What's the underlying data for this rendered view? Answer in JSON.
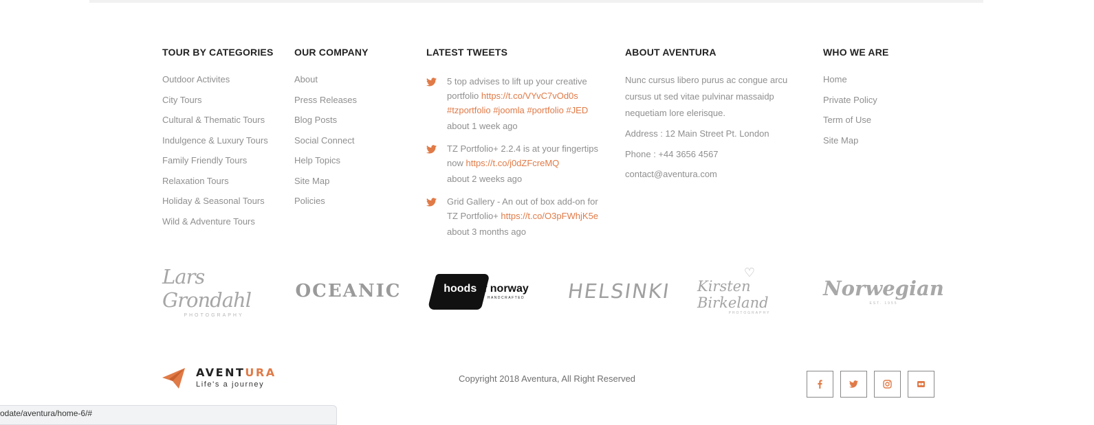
{
  "columns": {
    "tour_by_categories": {
      "title": "TOUR BY CATEGORIES",
      "items": [
        "Outdoor Activites",
        "City Tours",
        "Cultural & Thematic Tours",
        "Indulgence & Luxury Tours",
        "Family Friendly Tours",
        "Relaxation Tours",
        "Holiday & Seasonal Tours",
        "Wild & Adventure Tours"
      ]
    },
    "our_company": {
      "title": "OUR COMPANY",
      "items": [
        "About",
        "Press Releases",
        "Blog Posts",
        "Social Connect",
        "Help Topics",
        "Site Map",
        "Policies"
      ]
    },
    "latest_tweets": {
      "title": "LATEST TWEETS",
      "tweets": [
        {
          "text": "5 top advises to lift up your creative portfolio",
          "link": "https://t.co/VYvC7vOd0s",
          "tags": "#tzportfolio #joomla #portfolio #JED",
          "time": "about 1 week ago"
        },
        {
          "text": "TZ Portfolio+ 2.2.4 is at your fingertips now",
          "link": "https://t.co/j0dZFcreMQ",
          "tags": "",
          "time": "about 2 weeks ago"
        },
        {
          "text": "Grid Gallery - An out of box add-on for TZ Portfolio+",
          "link": "https://t.co/O3pFWhjK5e",
          "tags": "",
          "time": "about 3 months ago"
        }
      ]
    },
    "about_aventura": {
      "title": "ABOUT AVENTURA",
      "description": "Nunc cursus libero purus ac congue arcu cursus ut sed vitae pulvinar massaidp nequetiam lore elerisque.",
      "address": "Address : 12 Main Street Pt. London",
      "phone": "Phone : +44 3656 4567",
      "email": "contact@aventura.com"
    },
    "who_we_are": {
      "title": "WHO WE ARE",
      "items": [
        "Home",
        "Private Policy",
        "Term of Use",
        "Site Map"
      ]
    }
  },
  "partner_logos": {
    "lars": {
      "name": "Lars Grondahl",
      "sub": "PHOTOGRAPHY"
    },
    "oceanic": {
      "name": "OCEANIC"
    },
    "hoods": {
      "name_a": "hoods",
      "name_b": "of norway",
      "sub": "HANDCRAFTED"
    },
    "helsinki": {
      "name": "HELSINKI"
    },
    "kirsten": {
      "name": "Kirsten Birkeland",
      "sub": "PHOTOGRAPHY"
    },
    "norwegian": {
      "name": "Norwegian",
      "sub": "EST. 1955"
    }
  },
  "brand": {
    "name_a": "AVENT",
    "name_b": "URA",
    "tagline": "Life's a journey",
    "accent_color": "#e07a47"
  },
  "copyright": "Copyright 2018 Aventura, All Right Reserved",
  "social": [
    "facebook-icon",
    "twitter-icon",
    "instagram-icon",
    "flickr-icon"
  ],
  "status_url": "odate/aventura/home-6/#"
}
